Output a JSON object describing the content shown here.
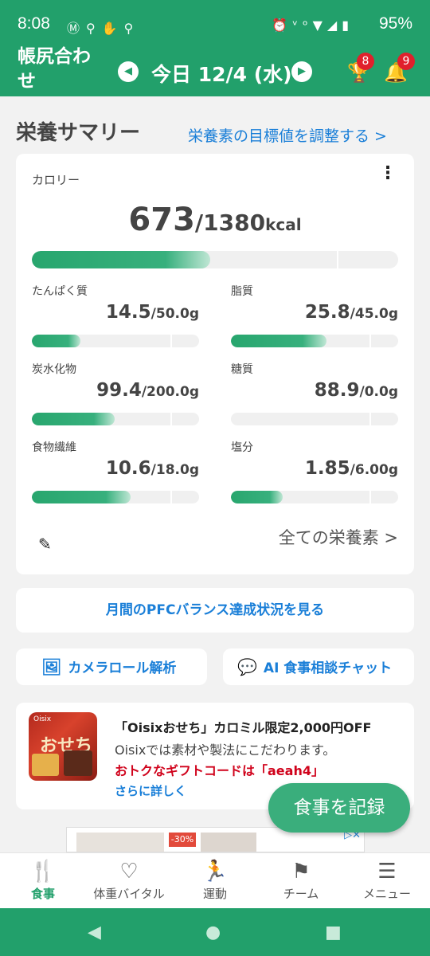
{
  "status_bar": {
    "time": "8:08",
    "left_icons": [
      "motorola-icon",
      "location-icon",
      "gesture-icon",
      "location-icon"
    ],
    "right_icons": [
      "alarm-icon",
      "volte-icon",
      "wifi-icon",
      "signal-icon",
      "battery-icon"
    ],
    "battery": "95%"
  },
  "header": {
    "app_name": "帳尻合わせ",
    "date_label": "今日 12/4 (水)",
    "trophy_badge": "8",
    "bell_badge": "9"
  },
  "summary": {
    "title": "栄養サマリー",
    "adjust_link": "栄養素の目標値を調整する >",
    "calories": {
      "label": "カロリー",
      "value": "673",
      "target": "/1380",
      "unit": "kcal",
      "progress": 0.488
    },
    "nutrients": [
      {
        "name": "たんぱく質",
        "value": "14.5",
        "target": "/50.0g",
        "progress": 0.29
      },
      {
        "name": "脂質",
        "value": "25.8",
        "target": "/45.0g",
        "progress": 0.573
      },
      {
        "name": "炭水化物",
        "value": "99.4",
        "target": "/200.0g",
        "progress": 0.497
      },
      {
        "name": "糖質",
        "value": "88.9",
        "target": "/0.0g",
        "progress": 0
      },
      {
        "name": "食物繊維",
        "value": "10.6",
        "target": "/18.0g",
        "progress": 0.589
      },
      {
        "name": "塩分",
        "value": "1.85",
        "target": "/6.00g",
        "progress": 0.308
      }
    ],
    "all_nutrients_link": "全ての栄養素 >"
  },
  "pfc_button": "月間のPFCバランス達成状況を見る",
  "camera_button": "カメラロール解析",
  "ai_button": "AI 食事相談チャット",
  "ad": {
    "image_brand": "Oisix",
    "image_title": "おせち",
    "title": "「Oisixおせち」カロミル限定2,000円OFF",
    "desc": "Oisixでは素材や製法にこだわります。",
    "promo": "おトクなギフトコードは「aeah4」",
    "more": "さらに詳しく"
  },
  "fab_label": "食事を記録",
  "banner": {
    "discount": "-30%"
  },
  "bottom_nav": [
    {
      "label": "食事",
      "icon": "fork-knife-icon",
      "active": true
    },
    {
      "label": "体重バイタル",
      "icon": "heart-scale-icon",
      "active": false
    },
    {
      "label": "運動",
      "icon": "runner-icon",
      "active": false
    },
    {
      "label": "チーム",
      "icon": "flag-icon",
      "active": false
    },
    {
      "label": "メニュー",
      "icon": "menu-list-icon",
      "active": false
    }
  ],
  "colors": {
    "brand": "#22a06b",
    "link": "#1a7fd8",
    "badge": "#e0202c",
    "promo": "#d0021b"
  }
}
